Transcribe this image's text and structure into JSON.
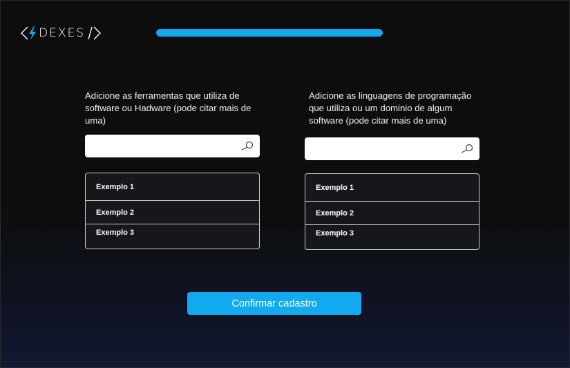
{
  "brand": {
    "name": "DEXES",
    "accent": "#12a9ef"
  },
  "progress": {
    "fraction": 1.0,
    "color": "#12a9ef"
  },
  "left": {
    "prompt": "Adicione as ferramentas que utiliza de software ou Hadware (pode citar mais de uma)",
    "search": {
      "value": "",
      "placeholder": "",
      "icon": "search-icon"
    },
    "items": [
      "Exemplo 1",
      "Exemplo 2",
      "Exemplo 3"
    ]
  },
  "right": {
    "prompt": "Adicione as linguagens de programação que utiliza ou um dominio de algum software (pode citar mais de uma)",
    "search": {
      "value": "",
      "placeholder": "",
      "icon": "search-icon"
    },
    "items": [
      "Exemplo 1",
      "Exemplo 2",
      "Exemplo 3"
    ]
  },
  "confirm": {
    "label": "Confirmar cadastro"
  }
}
